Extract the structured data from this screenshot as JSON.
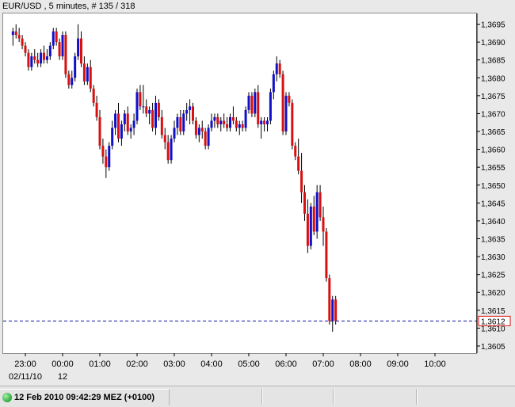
{
  "header": {
    "title": "EUR/USD , 5 minutes, # 135 / 318"
  },
  "status": {
    "text": "12 Feb 2010 09:42:29  MEZ (+0100)",
    "indicator_color": "#2aa83a"
  },
  "colors": {
    "up": "#1010c8",
    "down": "#d81010",
    "wick": "#000000",
    "current_line": "#1010a0",
    "price_box": "#d81010"
  },
  "chart_data": {
    "type": "candlestick",
    "symbol": "EUR/USD",
    "timeframe": "5 minutes",
    "x_tick_labels": [
      "23:00",
      "00:00",
      "01:00",
      "02:00",
      "03:00",
      "04:00",
      "05:00",
      "06:00",
      "07:00",
      "08:00",
      "09:00",
      "10:00"
    ],
    "date_labels": [
      {
        "text": "02/11/10",
        "at": "23:00"
      },
      {
        "text": "12",
        "at": "00:00"
      }
    ],
    "y_tick_labels": [
      "1,3695",
      "1,3690",
      "1,3685",
      "1,3680",
      "1,3675",
      "1,3670",
      "1,3665",
      "1,3660",
      "1,3655",
      "1,3650",
      "1,3645",
      "1,3640",
      "1,3635",
      "1,3630",
      "1,3625",
      "1,3620",
      "1,3615",
      "1,3610",
      "1,3605"
    ],
    "y_range": [
      1.3603,
      1.3698
    ],
    "current_price": 1.3612,
    "current_price_label": "1,3612",
    "grid": false,
    "start_time": "22:40",
    "bar_minutes": 5,
    "candles": [
      [
        1.3692,
        1.3694,
        1.3689,
        1.3693
      ],
      [
        1.3693,
        1.3695,
        1.3691,
        1.3692
      ],
      [
        1.3692,
        1.3694,
        1.369,
        1.3691
      ],
      [
        1.3691,
        1.3692,
        1.3688,
        1.3689
      ],
      [
        1.3689,
        1.369,
        1.3686,
        1.3687
      ],
      [
        1.3687,
        1.3688,
        1.3682,
        1.3683
      ],
      [
        1.3683,
        1.3687,
        1.3682,
        1.3686
      ],
      [
        1.3686,
        1.3688,
        1.3684,
        1.3685
      ],
      [
        1.3685,
        1.3687,
        1.3683,
        1.3684
      ],
      [
        1.3684,
        1.3688,
        1.3683,
        1.3687
      ],
      [
        1.3687,
        1.3689,
        1.3684,
        1.3685
      ],
      [
        1.3685,
        1.3688,
        1.3684,
        1.3686
      ],
      [
        1.3686,
        1.369,
        1.3685,
        1.3689
      ],
      [
        1.3689,
        1.3694,
        1.3688,
        1.3693
      ],
      [
        1.3693,
        1.3694,
        1.3689,
        1.369
      ],
      [
        1.369,
        1.3691,
        1.3685,
        1.3686
      ],
      [
        1.3686,
        1.3693,
        1.3685,
        1.3692
      ],
      [
        1.3692,
        1.3693,
        1.368,
        1.3681
      ],
      [
        1.3681,
        1.3682,
        1.3677,
        1.3678
      ],
      [
        1.3678,
        1.3682,
        1.3677,
        1.368
      ],
      [
        1.368,
        1.3687,
        1.3679,
        1.3686
      ],
      [
        1.3686,
        1.3695,
        1.3685,
        1.3691
      ],
      [
        1.3691,
        1.3693,
        1.3683,
        1.3684
      ],
      [
        1.3684,
        1.3686,
        1.3678,
        1.3679
      ],
      [
        1.3679,
        1.3684,
        1.3678,
        1.3683
      ],
      [
        1.3683,
        1.3685,
        1.3676,
        1.3677
      ],
      [
        1.3677,
        1.3678,
        1.3672,
        1.3673
      ],
      [
        1.3673,
        1.3675,
        1.3668,
        1.3669
      ],
      [
        1.3669,
        1.3671,
        1.366,
        1.3661
      ],
      [
        1.3661,
        1.3663,
        1.3656,
        1.3658
      ],
      [
        1.3658,
        1.366,
        1.3652,
        1.3655
      ],
      [
        1.3655,
        1.3662,
        1.3654,
        1.3661
      ],
      [
        1.3661,
        1.3668,
        1.366,
        1.3666
      ],
      [
        1.3666,
        1.3671,
        1.3664,
        1.367
      ],
      [
        1.367,
        1.3673,
        1.3662,
        1.3663
      ],
      [
        1.3663,
        1.3668,
        1.3661,
        1.3667
      ],
      [
        1.3667,
        1.3671,
        1.3665,
        1.367
      ],
      [
        1.367,
        1.3672,
        1.3664,
        1.3665
      ],
      [
        1.3665,
        1.3667,
        1.3663,
        1.3666
      ],
      [
        1.3666,
        1.367,
        1.3664,
        1.3668
      ],
      [
        1.3668,
        1.3677,
        1.3667,
        1.3676
      ],
      [
        1.3676,
        1.3678,
        1.3671,
        1.3672
      ],
      [
        1.3672,
        1.3678,
        1.367,
        1.3672
      ],
      [
        1.3672,
        1.3674,
        1.3669,
        1.367
      ],
      [
        1.367,
        1.3672,
        1.3667,
        1.3671
      ],
      [
        1.3671,
        1.3673,
        1.3665,
        1.3666
      ],
      [
        1.3666,
        1.3675,
        1.3664,
        1.3673
      ],
      [
        1.3673,
        1.3674,
        1.3668,
        1.3669
      ],
      [
        1.3669,
        1.3671,
        1.3663,
        1.3664
      ],
      [
        1.3664,
        1.3666,
        1.366,
        1.3662
      ],
      [
        1.3662,
        1.3664,
        1.3656,
        1.3657
      ],
      [
        1.3657,
        1.3664,
        1.3656,
        1.3663
      ],
      [
        1.3663,
        1.3668,
        1.3662,
        1.3666
      ],
      [
        1.3666,
        1.367,
        1.3664,
        1.3669
      ],
      [
        1.3669,
        1.3671,
        1.3664,
        1.3665
      ],
      [
        1.3665,
        1.3671,
        1.3664,
        1.367
      ],
      [
        1.367,
        1.3673,
        1.3668,
        1.3671
      ],
      [
        1.3671,
        1.3674,
        1.3667,
        1.3672
      ],
      [
        1.3672,
        1.3673,
        1.3667,
        1.3668
      ],
      [
        1.3668,
        1.3669,
        1.3663,
        1.3664
      ],
      [
        1.3664,
        1.3667,
        1.3662,
        1.3666
      ],
      [
        1.3666,
        1.3668,
        1.3663,
        1.3665
      ],
      [
        1.3665,
        1.3666,
        1.366,
        1.3661
      ],
      [
        1.3661,
        1.3667,
        1.366,
        1.3666
      ],
      [
        1.3666,
        1.367,
        1.3665,
        1.3668
      ],
      [
        1.3668,
        1.367,
        1.3666,
        1.3669
      ],
      [
        1.3669,
        1.367,
        1.3666,
        1.3667
      ],
      [
        1.3667,
        1.3669,
        1.3665,
        1.3668
      ],
      [
        1.3668,
        1.367,
        1.3666,
        1.3667
      ],
      [
        1.3667,
        1.3669,
        1.3665,
        1.3666
      ],
      [
        1.3666,
        1.367,
        1.3665,
        1.3669
      ],
      [
        1.3669,
        1.3672,
        1.3667,
        1.3668
      ],
      [
        1.3668,
        1.3669,
        1.3665,
        1.3666
      ],
      [
        1.3666,
        1.3668,
        1.3664,
        1.3667
      ],
      [
        1.3667,
        1.3668,
        1.3665,
        1.3666
      ],
      [
        1.3666,
        1.3672,
        1.3665,
        1.3671
      ],
      [
        1.3671,
        1.3676,
        1.367,
        1.3675
      ],
      [
        1.3675,
        1.3676,
        1.3669,
        1.367
      ],
      [
        1.367,
        1.3677,
        1.3669,
        1.3676
      ],
      [
        1.3676,
        1.3678,
        1.3666,
        1.3667
      ],
      [
        1.3667,
        1.3669,
        1.3663,
        1.3668
      ],
      [
        1.3668,
        1.3669,
        1.3665,
        1.3667
      ],
      [
        1.3667,
        1.3669,
        1.3665,
        1.3668
      ],
      [
        1.3668,
        1.3677,
        1.3667,
        1.3676
      ],
      [
        1.3676,
        1.3682,
        1.3674,
        1.3681
      ],
      [
        1.3681,
        1.3686,
        1.3679,
        1.3684
      ],
      [
        1.3684,
        1.3685,
        1.368,
        1.3681
      ],
      [
        1.3681,
        1.3682,
        1.3664,
        1.3665
      ],
      [
        1.3665,
        1.3676,
        1.3664,
        1.3675
      ],
      [
        1.3675,
        1.3676,
        1.3672,
        1.3673
      ],
      [
        1.3673,
        1.3674,
        1.366,
        1.3661
      ],
      [
        1.3661,
        1.3662,
        1.3657,
        1.3658
      ],
      [
        1.3658,
        1.3663,
        1.3653,
        1.3654
      ],
      [
        1.3654,
        1.3659,
        1.3645,
        1.3648
      ],
      [
        1.3648,
        1.365,
        1.364,
        1.3642
      ],
      [
        1.3642,
        1.3646,
        1.3631,
        1.3633
      ],
      [
        1.3633,
        1.3645,
        1.3632,
        1.3644
      ],
      [
        1.3644,
        1.3647,
        1.3636,
        1.3637
      ],
      [
        1.3637,
        1.365,
        1.3635,
        1.3648
      ],
      [
        1.3648,
        1.365,
        1.364,
        1.3641
      ],
      [
        1.3641,
        1.3644,
        1.3633,
        1.3637
      ],
      [
        1.3637,
        1.3638,
        1.3623,
        1.3624
      ],
      [
        1.3624,
        1.3625,
        1.3611,
        1.3612
      ],
      [
        1.3612,
        1.3619,
        1.3609,
        1.3618
      ],
      [
        1.3618,
        1.3619,
        1.3611,
        1.3612
      ]
    ]
  }
}
